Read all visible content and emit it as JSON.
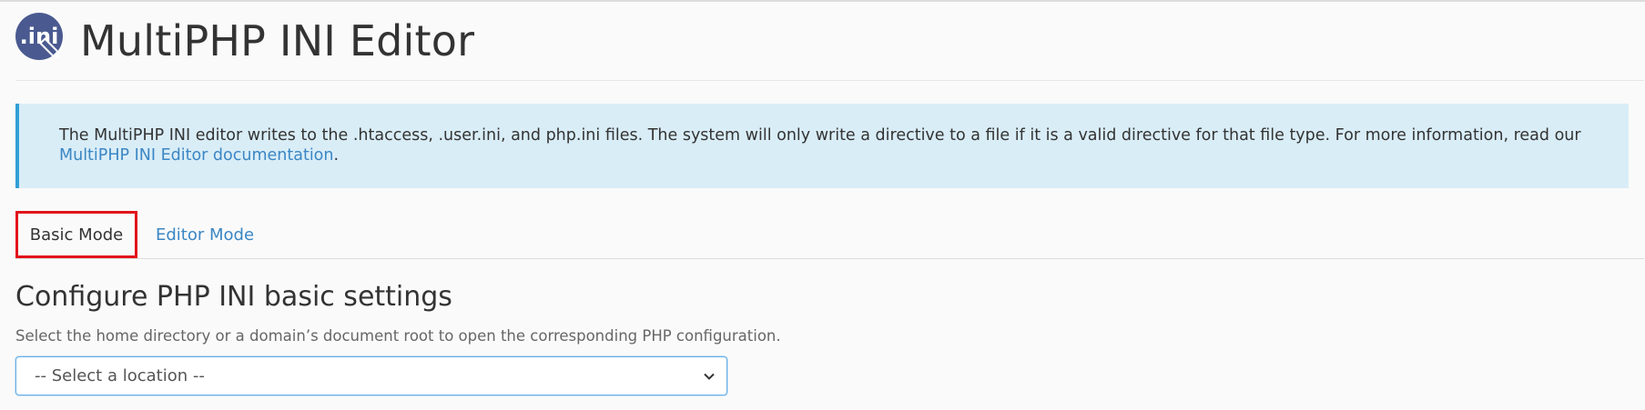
{
  "header": {
    "logo_text": ".ini",
    "title": "MultiPHP INI Editor"
  },
  "callout": {
    "text": "The MultiPHP INI editor writes to the .htaccess, .user.ini, and php.ini files. The system will only write a directive to a file if it is a valid directive for that file type. For more information, read our ",
    "link_text": "MultiPHP INI Editor documentation",
    "trailing": "."
  },
  "tabs": [
    {
      "label": "Basic Mode",
      "active": true
    },
    {
      "label": "Editor Mode",
      "active": false
    }
  ],
  "section": {
    "heading": "Configure PHP INI basic settings",
    "help": "Select the home directory or a domain’s document root to open the corresponding PHP configuration."
  },
  "location_select": {
    "value": "-- Select a location --"
  },
  "colors": {
    "link": "#3b86c4",
    "callout_bg": "#d9edf7",
    "callout_border": "#31a0d6",
    "active_tab_border": "#e1141b",
    "logo_bg": "#4a5a90"
  }
}
